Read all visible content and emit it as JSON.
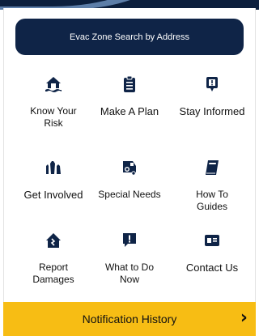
{
  "colors": {
    "navy": "#0f2447",
    "accent": "#f7bd14",
    "icon": "#0f2447"
  },
  "search": {
    "label": "Evac Zone Search by Address"
  },
  "tiles": [
    {
      "label": "Know Your Risk",
      "icon": "house-flood-icon"
    },
    {
      "label": "Make A Plan",
      "icon": "clipboard-checklist-icon"
    },
    {
      "label": "Stay Informed",
      "icon": "phone-alert-icon"
    },
    {
      "label": "Get Involved",
      "icon": "raised-hands-icon"
    },
    {
      "label": "Special Needs",
      "icon": "van-wheelchair-icon"
    },
    {
      "label": "How To Guides",
      "icon": "book-icon"
    },
    {
      "label": "Report Damages",
      "icon": "damaged-house-icon"
    },
    {
      "label": "What to Do Now",
      "icon": "speech-alert-icon"
    },
    {
      "label": "Contact Us",
      "icon": "contact-card-icon"
    }
  ],
  "notification": {
    "label": "Notification History",
    "chevron": "›"
  }
}
